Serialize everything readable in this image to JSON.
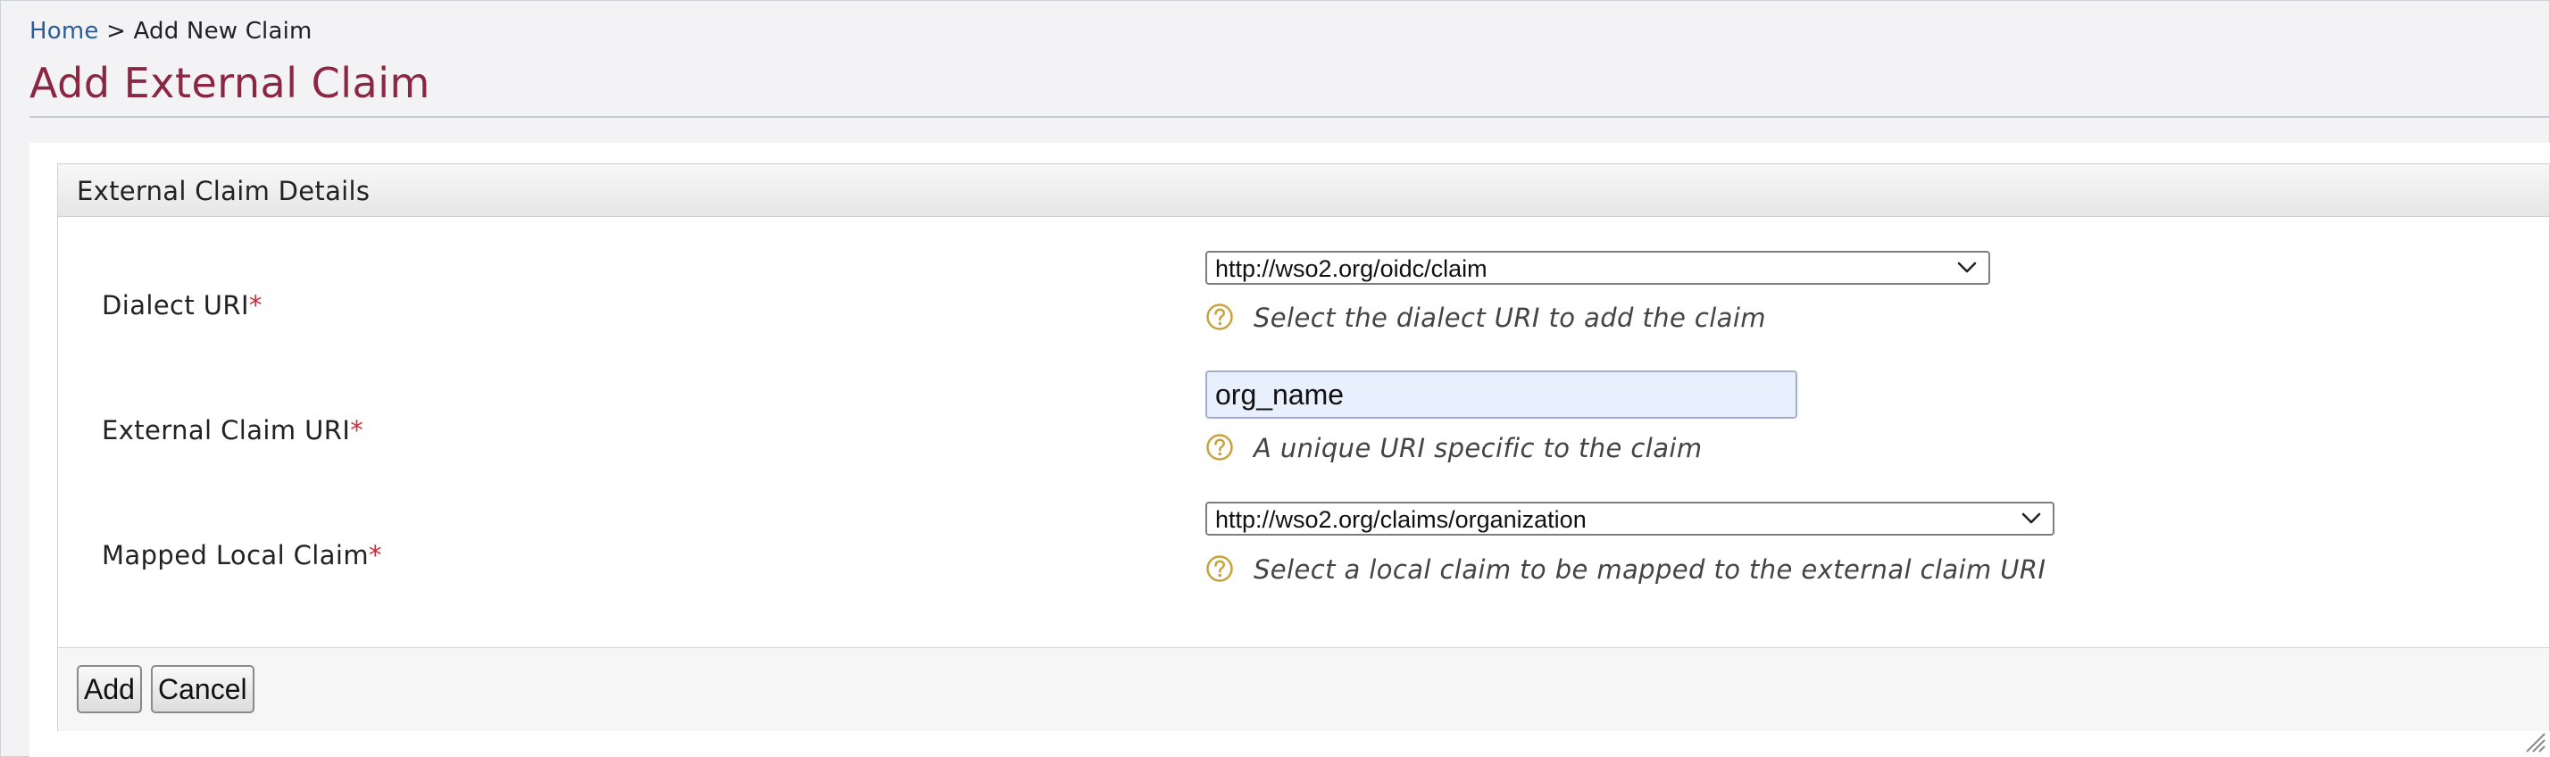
{
  "breadcrumb": {
    "home": "Home",
    "separator": ">",
    "current": "Add New Claim"
  },
  "page": {
    "title": "Add External Claim"
  },
  "panel": {
    "title": "External Claim Details"
  },
  "form": {
    "required_marker": "*",
    "dialect": {
      "label": "Dialect URI",
      "selected": "http://wso2.org/oidc/claim",
      "help": "Select the dialect URI to add the claim"
    },
    "external_claim": {
      "label": "External Claim URI",
      "value": "org_name",
      "help": "A unique URI specific to the claim"
    },
    "mapped_local": {
      "label": "Mapped Local Claim",
      "selected": "http://wso2.org/claims/organization",
      "help": "Select a local claim to be mapped to the external claim URI"
    }
  },
  "buttons": {
    "add": "Add",
    "cancel": "Cancel"
  },
  "icons": {
    "help": "question-circle-icon",
    "dropdown": "chevron-down-icon",
    "resize": "resize-grip-icon"
  },
  "colors": {
    "title": "#8b2742",
    "link": "#2a5d9a",
    "required": "#d2293a",
    "help_icon": "#c9a23c",
    "input_bg": "#e8effd"
  }
}
